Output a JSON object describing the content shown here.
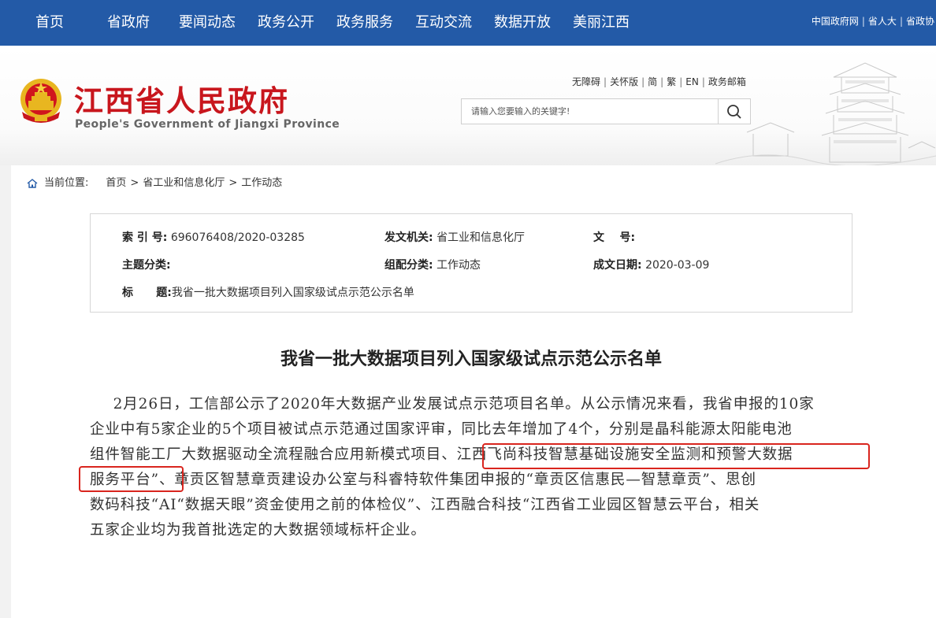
{
  "topnav": {
    "items": [
      "首页",
      "省政府",
      "要闻动态",
      "政务公开",
      "政务服务",
      "互动交流",
      "数据开放",
      "美丽江西"
    ],
    "right_links": [
      "中国政府网",
      "省人大",
      "省政协"
    ]
  },
  "header": {
    "title": "江西省人民政府",
    "subtitle": "People's Government of Jiangxi Province",
    "util_links": [
      "无障碍",
      "关怀版",
      "简",
      "繁",
      "EN",
      "政务邮箱"
    ],
    "search_placeholder": "请输入您要输入的关键字!"
  },
  "breadcrumb": {
    "label": "当前位置:",
    "items": [
      "首页",
      "省工业和信息化厅",
      "工作动态"
    ],
    "separator": ">"
  },
  "meta": {
    "index_no_label": "索 引 号:",
    "index_no": "696076408/2020-03285",
    "issuer_label": "发文机关:",
    "issuer": "省工业和信息化厅",
    "doc_no_label": "文    号:",
    "doc_no": "",
    "topic_label": "主题分类:",
    "topic": "",
    "category_label": "组配分类:",
    "category": "工作动态",
    "date_label": "成文日期:",
    "date": "2020-03-09",
    "title_label": "标      题:",
    "title": "我省一批大数据项目列入国家级试点示范公示名单"
  },
  "article": {
    "title": "我省一批大数据项目列入国家级试点示范公示名单",
    "body_lines": [
      "2月26日，工信部公示了2020年大数据产业发展试点示范项目名单。从公示情况来看，我省申报的10家",
      "企业中有5家企业的5个项目被试点示范通过国家评审，同比去年增加了4个，分别是晶科能源太阳能电池",
      "组件智能工厂大数据驱动全流程融合应用新模式项目、江西飞尚科技智慧基础设施安全监测和预警大数据",
      "服务平台”、章贡区智慧章贡建设办公室与科睿特软件集团申报的“章贡区信惠民—智慧章贡”、思创",
      "数码科技“AI“数据天眼”资金使用之前的体检仪”、江西融合科技“江西省工业园区智慧云平台，相关",
      "五家企业均为我首批选定的大数据领域标杆企业。"
    ]
  },
  "colors": {
    "nav_bg": "#235aa7",
    "title_red": "#c8161d",
    "highlight_red": "#d9251e"
  }
}
